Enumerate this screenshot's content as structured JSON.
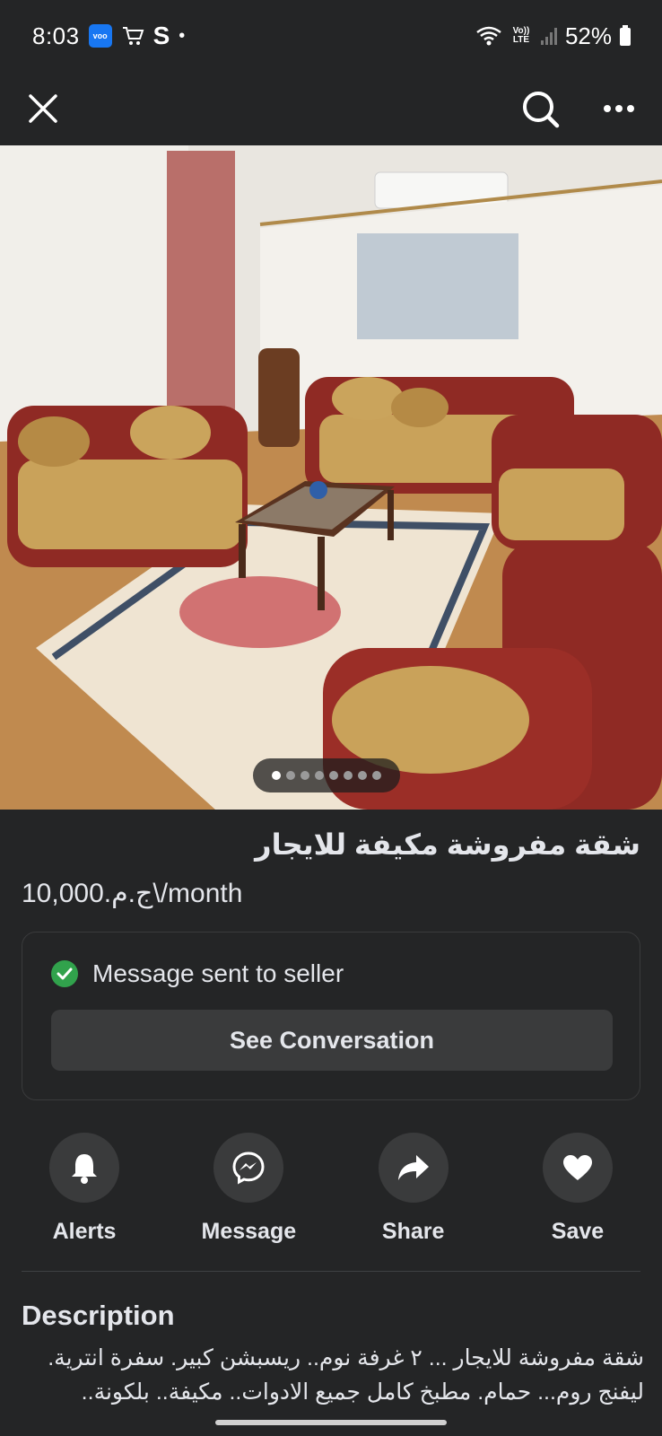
{
  "status_bar": {
    "time": "8:03",
    "carrier_letter": "S",
    "volte": "Vo)) LTE",
    "battery": "52%"
  },
  "top_bar": {
    "close_icon": "close-icon",
    "search_icon": "search-icon",
    "more_icon": "more-horizontal-icon"
  },
  "gallery": {
    "dot_count": 8,
    "active_index": 0
  },
  "listing": {
    "title": "شقة مفروشة مكيفة للايجار",
    "price": "ج.م.10,000\\/month"
  },
  "message_card": {
    "status": "Message sent to seller",
    "button": "See Conversation"
  },
  "actions": [
    {
      "label": "Alerts",
      "icon": "bell-icon"
    },
    {
      "label": "Message",
      "icon": "messenger-icon"
    },
    {
      "label": "Share",
      "icon": "share-arrow-icon"
    },
    {
      "label": "Save",
      "icon": "heart-icon"
    }
  ],
  "description": {
    "heading": "Description",
    "line1": "شقة مفروشة للايجار ... ٢ غرفة نوم.. ريسبشن كبير. سفرة انترية.",
    "line2": "ليفنج روم... حمام. مطبخ كامل جميع الادوات.. مكيفة.. بلكونة.."
  },
  "colors": {
    "background": "#242526",
    "button_bg": "#3a3b3c",
    "success": "#31a24c",
    "text": "#e4e6eb"
  }
}
